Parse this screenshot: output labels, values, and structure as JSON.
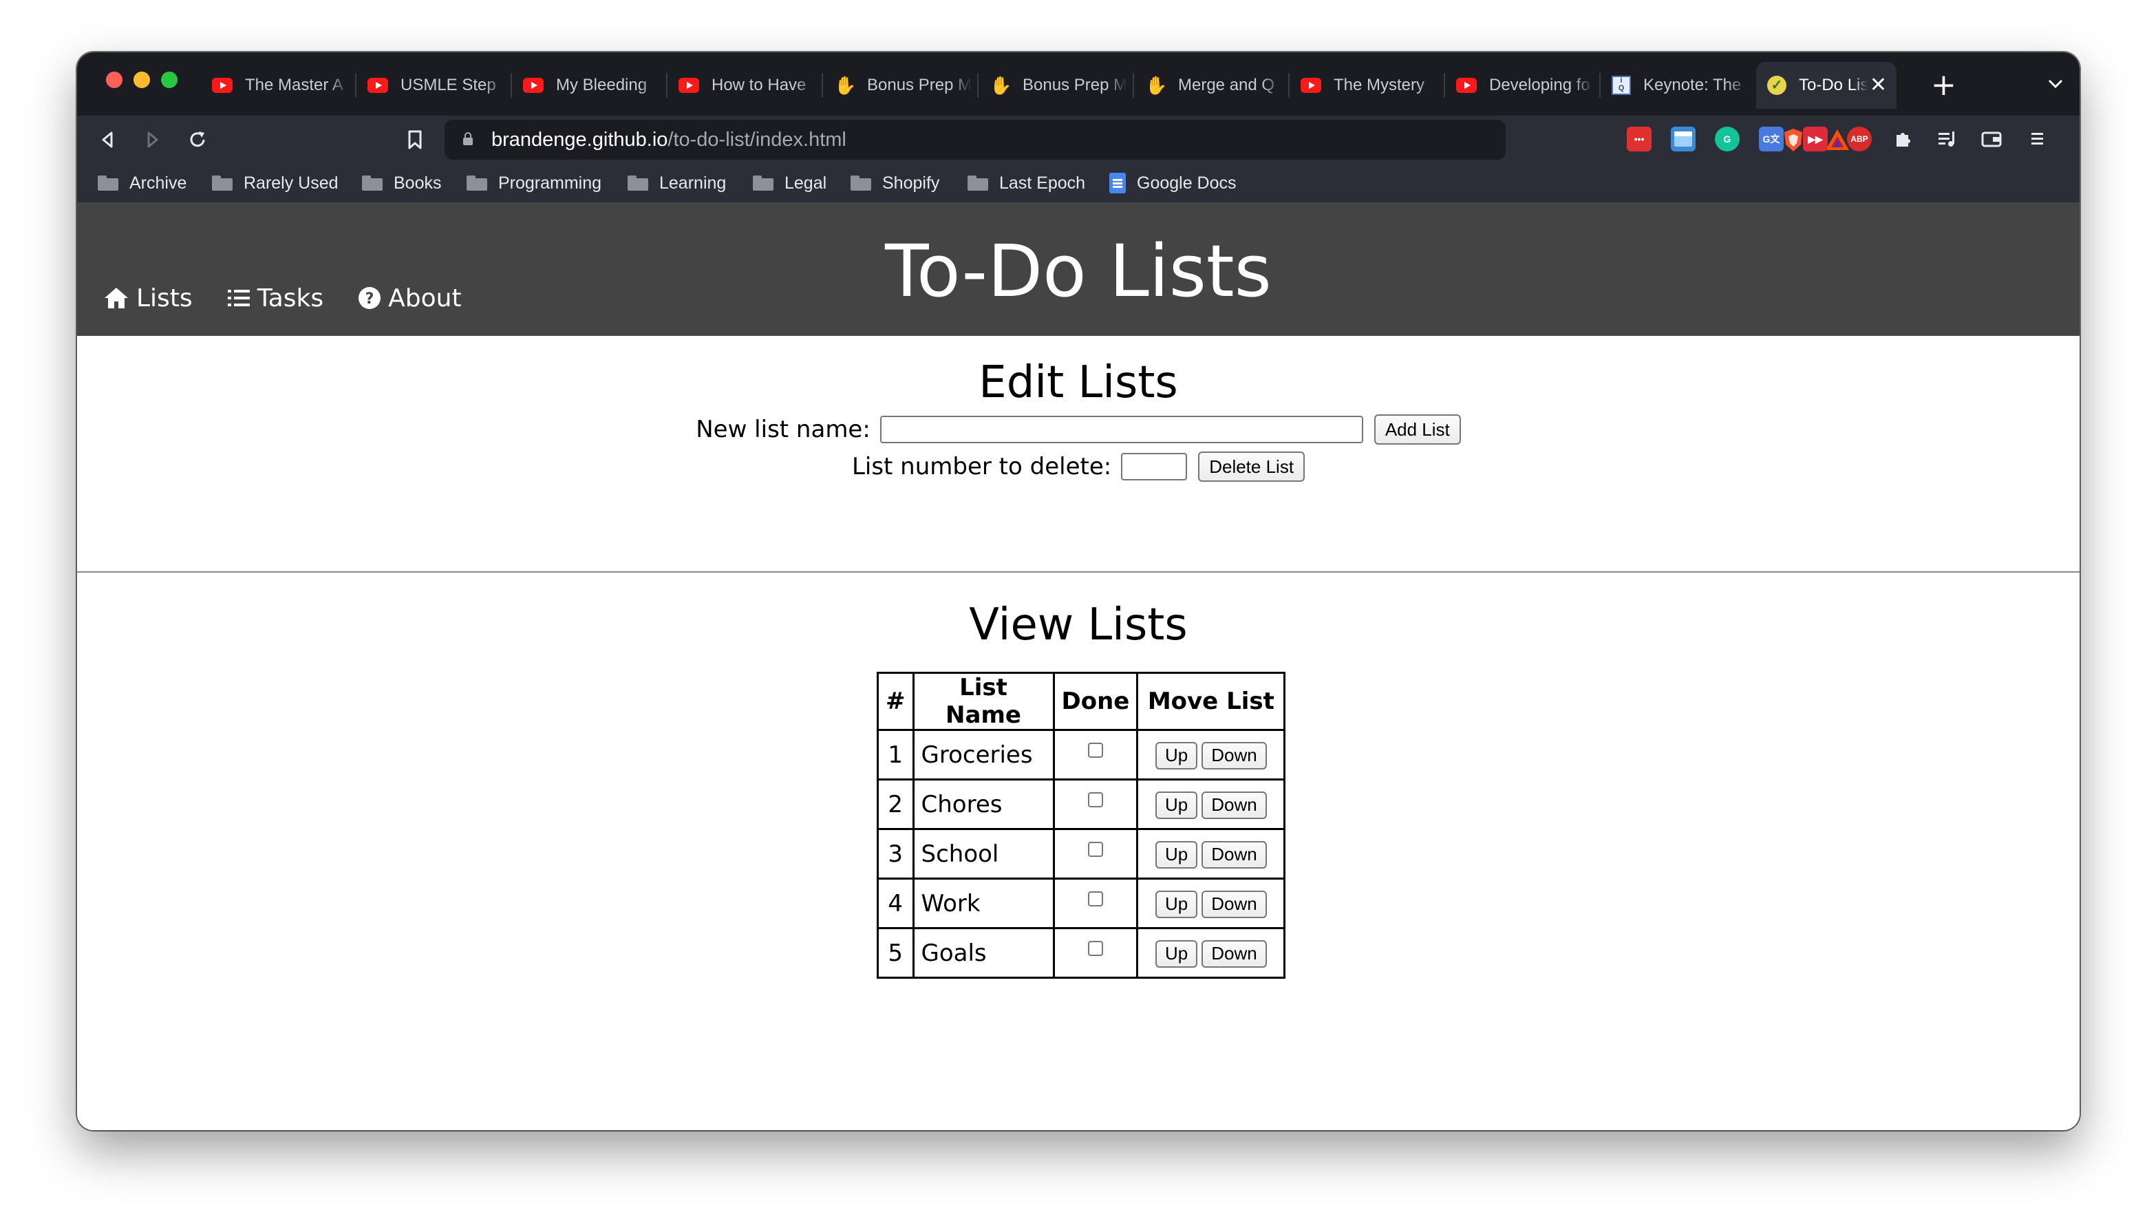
{
  "browser": {
    "tabs": [
      {
        "title": "The Master A",
        "icon": "youtube-icon"
      },
      {
        "title": "USMLE Step",
        "icon": "youtube-icon"
      },
      {
        "title": "My Bleeding",
        "icon": "youtube-icon"
      },
      {
        "title": "How to Have",
        "icon": "youtube-icon"
      },
      {
        "title": "Bonus Prep M",
        "icon": "hand-icon"
      },
      {
        "title": "Bonus Prep M",
        "icon": "hand-icon"
      },
      {
        "title": "Merge and Q",
        "icon": "hand-icon"
      },
      {
        "title": "The Mystery",
        "icon": "youtube-icon"
      },
      {
        "title": "Developing fo",
        "icon": "youtube-icon"
      },
      {
        "title": "Keynote: The",
        "icon": "infoq-icon"
      },
      {
        "title": "To-Do Lis",
        "icon": "todo-check-icon",
        "active": true
      }
    ],
    "url": {
      "host": "brandenge.github.io",
      "path": "/to-do-list/index.html"
    },
    "bookmarks": [
      {
        "label": "Archive",
        "icon": "folder-icon"
      },
      {
        "label": "Rarely Used",
        "icon": "folder-icon"
      },
      {
        "label": "Books",
        "icon": "folder-icon"
      },
      {
        "label": "Programming",
        "icon": "folder-icon"
      },
      {
        "label": "Learning",
        "icon": "folder-icon"
      },
      {
        "label": "Legal",
        "icon": "folder-icon"
      },
      {
        "label": "Shopify",
        "icon": "folder-icon"
      },
      {
        "label": "Last Epoch",
        "icon": "folder-icon"
      },
      {
        "label": "Google Docs",
        "icon": "google-docs-icon"
      }
    ],
    "extensions": {
      "abp_label": "ABP"
    }
  },
  "site": {
    "title": "To-Do Lists",
    "nav": [
      {
        "label": "Lists",
        "icon": "home-icon"
      },
      {
        "label": "Tasks",
        "icon": "list-icon"
      },
      {
        "label": "About",
        "icon": "question-circle-icon"
      }
    ]
  },
  "edit": {
    "heading": "Edit Lists",
    "new_list_label": "New list name:",
    "new_list_value": "",
    "add_button": "Add List",
    "delete_label": "List number to delete:",
    "delete_value": "",
    "delete_button": "Delete List"
  },
  "view": {
    "heading": "View Lists",
    "columns": [
      "#",
      "List Name",
      "Done",
      "Move List"
    ],
    "rows": [
      {
        "num": "1",
        "name": "Groceries",
        "done": false
      },
      {
        "num": "2",
        "name": "Chores",
        "done": false
      },
      {
        "num": "3",
        "name": "School",
        "done": false
      },
      {
        "num": "4",
        "name": "Work",
        "done": false
      },
      {
        "num": "5",
        "name": "Goals",
        "done": false
      }
    ],
    "up_label": "Up",
    "down_label": "Down"
  },
  "colors": {
    "header_bg": "#444444",
    "browser_dark": "#1b1c22",
    "browser_toolbar": "#2b2d37"
  }
}
